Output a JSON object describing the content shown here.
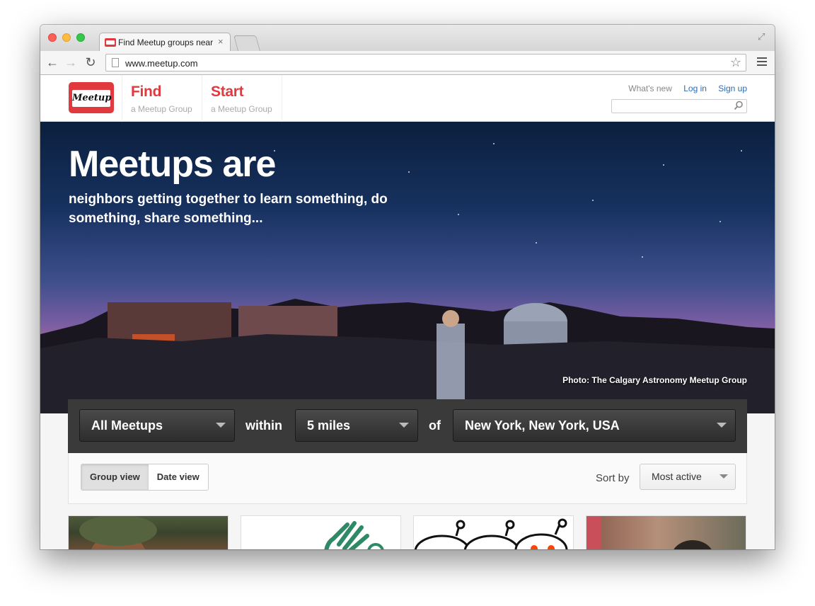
{
  "browser": {
    "tab_title": "Find Meetup groups near y",
    "tab_close": "×",
    "url": "www.meetup.com"
  },
  "header": {
    "logo_text": "Meetup",
    "find": {
      "big": "Find",
      "small": "a Meetup Group"
    },
    "start": {
      "big": "Start",
      "small": "a Meetup Group"
    },
    "links": {
      "whats_new": "What's new",
      "login": "Log in",
      "signup": "Sign up"
    },
    "search_placeholder": ""
  },
  "hero": {
    "title": "Meetups are",
    "subtitle": "neighbors getting together to learn something, do something, share something...",
    "credit": "Photo: The Calgary Astronomy Meetup Group"
  },
  "filters": {
    "category": "All Meetups",
    "within": "within",
    "distance": "5 miles",
    "of": "of",
    "location": "New York, New York, USA"
  },
  "controls": {
    "group_view": "Group view",
    "date_view": "Date view",
    "sort_by": "Sort by",
    "sort_value": "Most active"
  },
  "colors": {
    "brand_red": "#e0393e",
    "link_blue": "#2a6cb4",
    "filter_bar": "#3a3a3a"
  }
}
